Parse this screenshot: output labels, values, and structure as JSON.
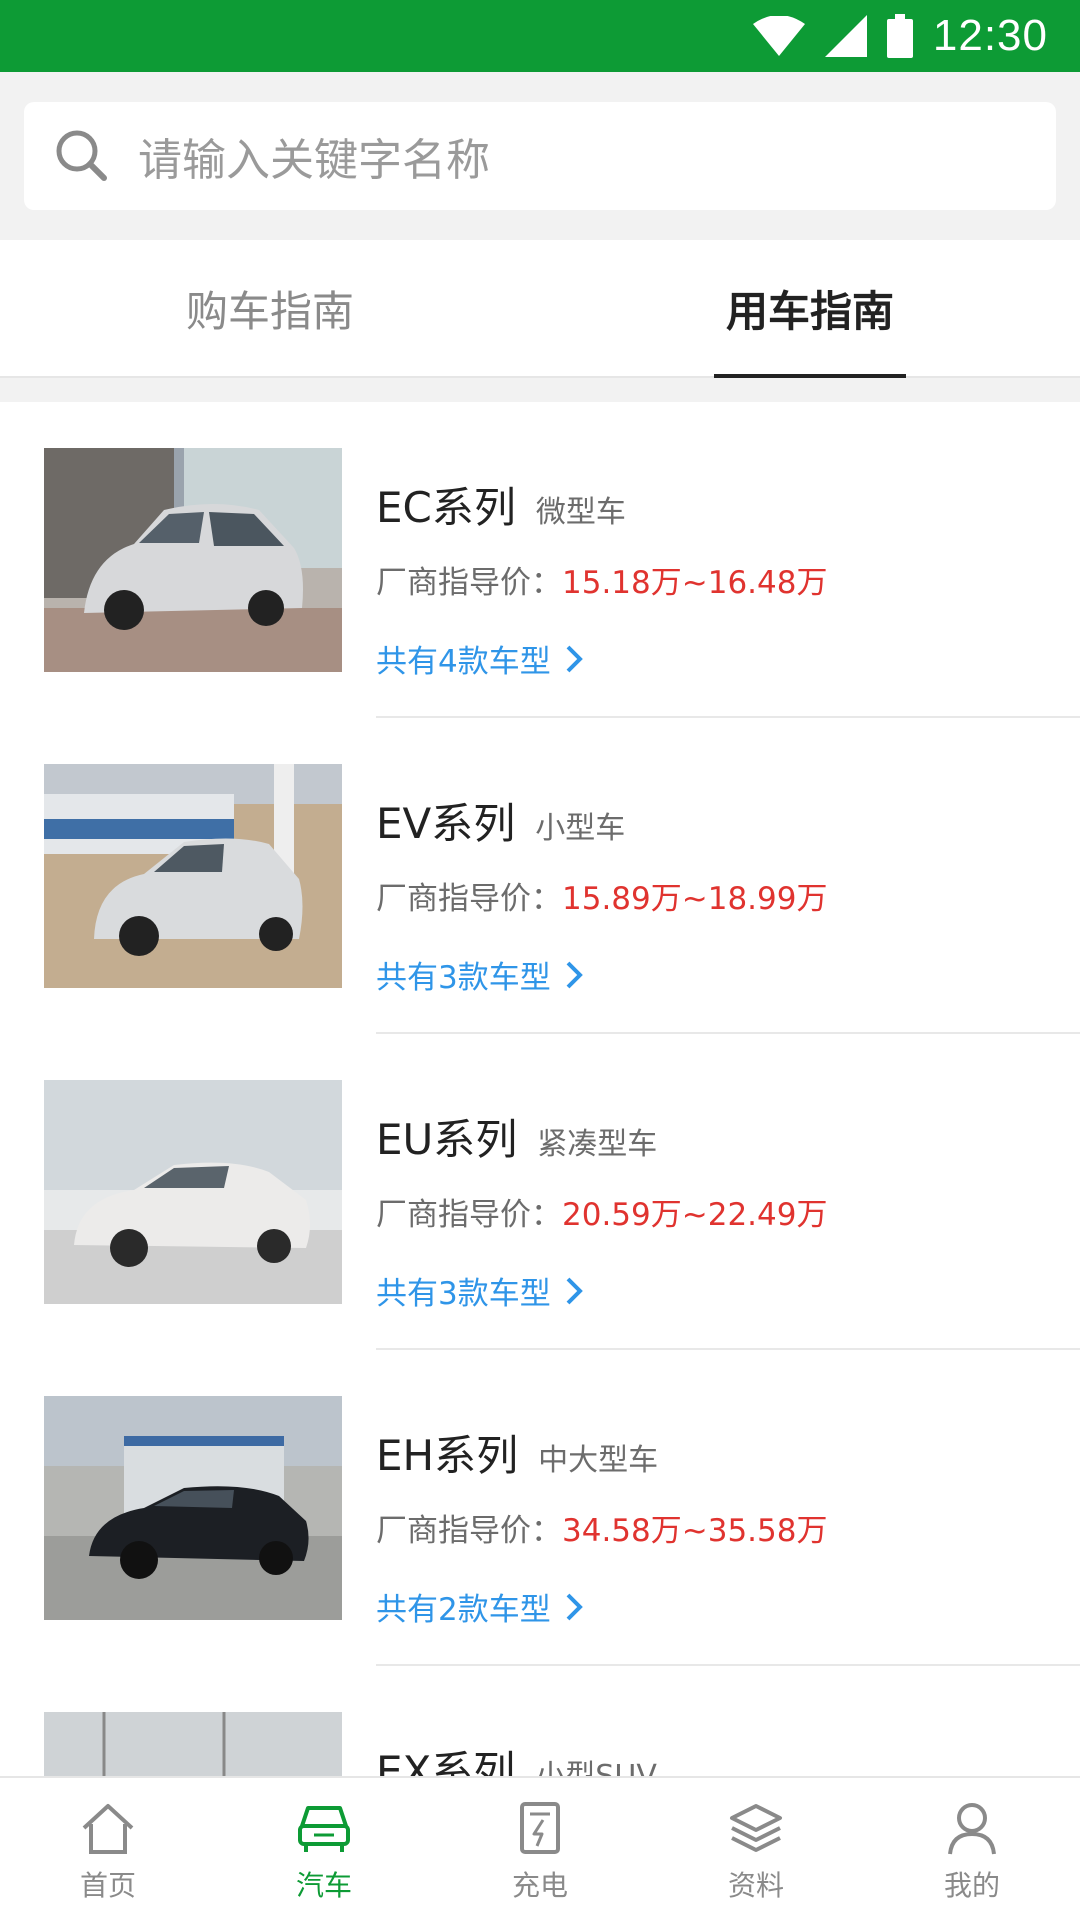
{
  "status_bar": {
    "time": "12:30"
  },
  "search": {
    "placeholder": "请输入关键字名称"
  },
  "tabs": [
    {
      "label": "购车指南",
      "active": false
    },
    {
      "label": "用车指南",
      "active": true
    }
  ],
  "cars": [
    {
      "series": "EC系列",
      "category": "微型车",
      "price_label": "厂商指导价：",
      "price": "15.18万~16.48万",
      "models": "共有4款车型"
    },
    {
      "series": "EV系列",
      "category": "小型车",
      "price_label": "厂商指导价：",
      "price": "15.89万~18.99万",
      "models": "共有3款车型"
    },
    {
      "series": "EU系列",
      "category": "紧凑型车",
      "price_label": "厂商指导价：",
      "price": "20.59万~22.49万",
      "models": "共有3款车型"
    },
    {
      "series": "EH系列",
      "category": "中大型车",
      "price_label": "厂商指导价：",
      "price": "34.58万~35.58万",
      "models": "共有2款车型"
    },
    {
      "series": "EX系列",
      "category": "小型SUV"
    }
  ],
  "bottom_nav": [
    {
      "label": "首页",
      "icon": "home-icon",
      "active": false
    },
    {
      "label": "汽车",
      "icon": "car-icon",
      "active": true
    },
    {
      "label": "充电",
      "icon": "charging-icon",
      "active": false
    },
    {
      "label": "资料",
      "icon": "layers-icon",
      "active": false
    },
    {
      "label": "我的",
      "icon": "user-icon",
      "active": false
    }
  ],
  "colors": {
    "brand_green": "#0d9b35",
    "price_red": "#e0332f",
    "link_blue": "#2f95e8"
  }
}
